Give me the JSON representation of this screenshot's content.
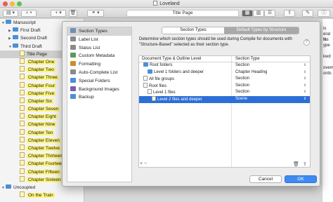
{
  "window": {
    "title": "Loveland"
  },
  "toolbar": {
    "doc_title": "Title Page"
  },
  "binder": {
    "items": [
      {
        "label": "Manuscript",
        "indent": 0,
        "kind": "folder",
        "tri": "▼"
      },
      {
        "label": "First Draft",
        "indent": 1,
        "kind": "folder",
        "tri": "▶"
      },
      {
        "label": "Second Draft",
        "indent": 1,
        "kind": "folder",
        "tri": "▶"
      },
      {
        "label": "Third Draft",
        "indent": 1,
        "kind": "folder",
        "tri": "▼"
      },
      {
        "label": "Title Page",
        "indent": 2,
        "kind": "doc",
        "tri": "",
        "highlight": false,
        "selected": true
      },
      {
        "label": "Chapter One",
        "indent": 2,
        "kind": "doc",
        "tri": "",
        "highlight": true
      },
      {
        "label": "Chapter Two",
        "indent": 2,
        "kind": "doc",
        "tri": "",
        "highlight": true
      },
      {
        "label": "Chapter Three",
        "indent": 2,
        "kind": "doc",
        "tri": "",
        "highlight": true
      },
      {
        "label": "Chapter Four",
        "indent": 2,
        "kind": "doc",
        "tri": "",
        "highlight": true
      },
      {
        "label": "Chapter Five",
        "indent": 2,
        "kind": "doc",
        "tri": "",
        "highlight": true
      },
      {
        "label": "Chapter Six",
        "indent": 2,
        "kind": "doc",
        "tri": "",
        "highlight": true
      },
      {
        "label": "Chapter Seven",
        "indent": 2,
        "kind": "doc",
        "tri": "",
        "highlight": true
      },
      {
        "label": "Chapter Eight",
        "indent": 2,
        "kind": "doc",
        "tri": "",
        "highlight": true
      },
      {
        "label": "Chapter Nine",
        "indent": 2,
        "kind": "doc",
        "tri": "",
        "highlight": true
      },
      {
        "label": "Chapter Ten",
        "indent": 2,
        "kind": "doc",
        "tri": "",
        "highlight": true
      },
      {
        "label": "Chapter Eleven",
        "indent": 2,
        "kind": "doc",
        "tri": "",
        "highlight": true
      },
      {
        "label": "Chapter Twelve",
        "indent": 2,
        "kind": "doc",
        "tri": "",
        "highlight": true
      },
      {
        "label": "Chapter Thirteen",
        "indent": 2,
        "kind": "doc",
        "tri": "",
        "highlight": true
      },
      {
        "label": "Chapter Fourteen",
        "indent": 2,
        "kind": "doc",
        "tri": "",
        "highlight": true
      },
      {
        "label": "Chapter Fifteen",
        "indent": 2,
        "kind": "doc",
        "tri": "",
        "highlight": true
      },
      {
        "label": "Chapter Sixteen",
        "indent": 2,
        "kind": "doc",
        "tri": "",
        "highlight": true
      },
      {
        "label": "Uncoupled",
        "indent": 0,
        "kind": "folder",
        "tri": "▼"
      },
      {
        "label": "On the Train",
        "indent": 2,
        "kind": "doc",
        "tri": "",
        "highlight": true
      }
    ]
  },
  "editor_right": {
    "lines": [
      "is",
      "eral N",
      "ins",
      "ype",
      "",
      "kwd",
      "",
      "ovemb",
      "ords"
    ]
  },
  "dialog": {
    "categories": [
      {
        "label": "Section Types",
        "icon": "section-types-icon",
        "color": "#6c8fb7",
        "selected": true
      },
      {
        "label": "Label List",
        "icon": "label-list-icon",
        "color": "#8a8a8a"
      },
      {
        "label": "Status List",
        "icon": "status-list-icon",
        "color": "#8a8a8a"
      },
      {
        "label": "Custom Metadata",
        "icon": "custom-metadata-icon",
        "color": "#5a9a5a"
      },
      {
        "label": "Formatting",
        "icon": "formatting-icon",
        "color": "#c98f2a"
      },
      {
        "label": "Auto-Complete List",
        "icon": "auto-complete-icon",
        "color": "#8a8a8a"
      },
      {
        "label": "Special Folders",
        "icon": "special-folders-icon",
        "color": "#4a8fd8"
      },
      {
        "label": "Background Images",
        "icon": "background-images-icon",
        "color": "#7a5fb0"
      },
      {
        "label": "Backup",
        "icon": "backup-icon",
        "color": "#4a8fd8"
      }
    ],
    "tabs": {
      "section_types": "Section Types",
      "default_types": "Default Types by Structure"
    },
    "description": "Determine which section types should be used during Compile for documents with \"Structure-Based\" selected as their section type.",
    "help": "?",
    "table": {
      "col1": "Document Type & Outline Level",
      "col2": "Section Type",
      "rows": [
        {
          "doc": "Root folders",
          "type": "Section",
          "indent": 1,
          "icon": "folder"
        },
        {
          "doc": "Level 1 folders and deeper",
          "type": "Chapter Heading",
          "indent": 2,
          "icon": "folder"
        },
        {
          "doc": "All file groups",
          "type": "Section",
          "indent": 1,
          "icon": "files"
        },
        {
          "doc": "Root files",
          "type": "Section",
          "indent": 1,
          "icon": "files"
        },
        {
          "doc": "Level 1 files",
          "type": "Section",
          "indent": 2,
          "icon": "files"
        },
        {
          "doc": "Level 2 files and deeper",
          "type": "Scene",
          "indent": 3,
          "icon": "files",
          "selected": true
        }
      ]
    },
    "footer_left": "+ −",
    "buttons": {
      "cancel": "Cancel",
      "ok": "OK"
    }
  }
}
